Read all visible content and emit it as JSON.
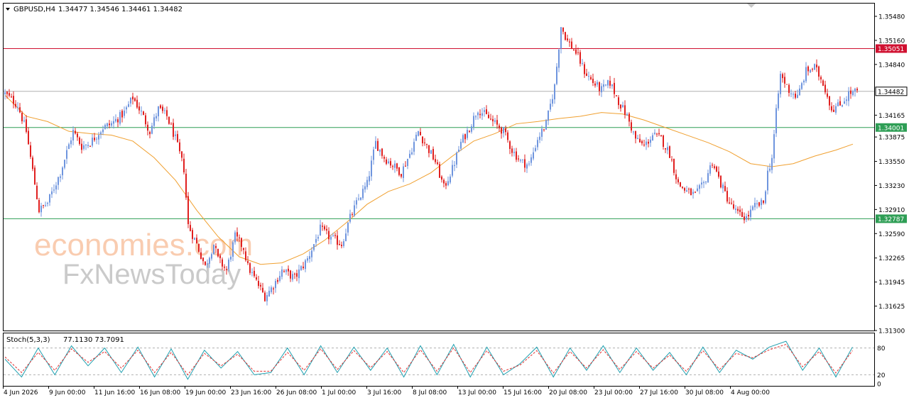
{
  "main_header": {
    "symbol": "GBPUSD,H4",
    "ohlc": "1.34477 1.34546 1.34461 1.34482"
  },
  "stoch_header": {
    "label": "Stoch(5,3,3)",
    "values": "77.1130 73.7091"
  },
  "watermark": {
    "line1": "economies.com",
    "line2": "FxNewsToday"
  },
  "colors": {
    "bull": "#6F95DE",
    "bear": "#E02020",
    "ma": "#F0A030",
    "resistance": "#D01030",
    "support": "#2E9E55",
    "current": "#B0B0B0",
    "stoch_main": "#20A0B0",
    "stoch_signal": "#E03030"
  },
  "chart_data": [
    {
      "type": "candlestick",
      "symbol": "GBPUSD",
      "timeframe": "H4",
      "x_tick_labels": [
        "4 Jun 2026",
        "9 Jun 00:00",
        "11 Jun 16:00",
        "16 Jun 08:00",
        "19 Jun 00:00",
        "23 Jun 16:00",
        "26 Jun 08:00",
        "1 Jul 00:00",
        "3 Jul 16:00",
        "8 Jul 08:00",
        "13 Jul 00:00",
        "15 Jul 16:00",
        "20 Jul 08:00",
        "23 Jul 00:00",
        "27 Jul 16:00",
        "30 Jul 08:00",
        "4 Aug 00:00"
      ],
      "y_tick_labels": [
        "1.35480",
        "1.35160",
        "1.34840",
        "1.34165",
        "1.33875",
        "1.33550",
        "1.33230",
        "1.32910",
        "1.32590",
        "1.32265",
        "1.31945",
        "1.31625",
        "1.31300"
      ],
      "ylim": [
        1.313,
        1.3565
      ],
      "horizontal_levels": [
        {
          "value": 1.35051,
          "label": "1.35051",
          "role": "resistance"
        },
        {
          "value": 1.34482,
          "label": "1.34482",
          "role": "current"
        },
        {
          "value": 1.34001,
          "label": "1.34001",
          "role": "support"
        },
        {
          "value": 1.32787,
          "label": "1.32787",
          "role": "support"
        }
      ],
      "close_path": [
        [
          0,
          1.3445
        ],
        [
          6,
          1.343
        ],
        [
          10,
          1.3395
        ],
        [
          16,
          1.329
        ],
        [
          20,
          1.33
        ],
        [
          26,
          1.334
        ],
        [
          32,
          1.3395
        ],
        [
          36,
          1.3375
        ],
        [
          40,
          1.338
        ],
        [
          46,
          1.34
        ],
        [
          50,
          1.3405
        ],
        [
          56,
          1.342
        ],
        [
          60,
          1.344
        ],
        [
          64,
          1.342
        ],
        [
          68,
          1.3395
        ],
        [
          72,
          1.3425
        ],
        [
          76,
          1.3415
        ],
        [
          80,
          1.3385
        ],
        [
          84,
          1.3345
        ],
        [
          86,
          1.327
        ],
        [
          90,
          1.3245
        ],
        [
          94,
          1.3215
        ],
        [
          98,
          1.3245
        ],
        [
          100,
          1.3225
        ],
        [
          104,
          1.321
        ],
        [
          108,
          1.3255
        ],
        [
          112,
          1.324
        ],
        [
          114,
          1.3215
        ],
        [
          118,
          1.3195
        ],
        [
          122,
          1.3175
        ],
        [
          126,
          1.319
        ],
        [
          130,
          1.321
        ],
        [
          136,
          1.32
        ],
        [
          142,
          1.3225
        ],
        [
          148,
          1.3265
        ],
        [
          152,
          1.3255
        ],
        [
          158,
          1.3245
        ],
        [
          162,
          1.328
        ],
        [
          166,
          1.3305
        ],
        [
          170,
          1.3325
        ],
        [
          174,
          1.338
        ],
        [
          178,
          1.336
        ],
        [
          182,
          1.335
        ],
        [
          186,
          1.334
        ],
        [
          190,
          1.3365
        ],
        [
          194,
          1.3395
        ],
        [
          198,
          1.3375
        ],
        [
          202,
          1.3355
        ],
        [
          206,
          1.332
        ],
        [
          210,
          1.3345
        ],
        [
          214,
          1.338
        ],
        [
          218,
          1.34
        ],
        [
          222,
          1.3425
        ],
        [
          226,
          1.3415
        ],
        [
          230,
          1.3405
        ],
        [
          234,
          1.3395
        ],
        [
          238,
          1.337
        ],
        [
          242,
          1.3355
        ],
        [
          246,
          1.335
        ],
        [
          250,
          1.3385
        ],
        [
          254,
          1.3405
        ],
        [
          258,
          1.3455
        ],
        [
          261,
          1.3535
        ],
        [
          264,
          1.3515
        ],
        [
          268,
          1.35
        ],
        [
          272,
          1.3475
        ],
        [
          276,
          1.346
        ],
        [
          280,
          1.345
        ],
        [
          284,
          1.346
        ],
        [
          288,
          1.3435
        ],
        [
          292,
          1.3415
        ],
        [
          296,
          1.3385
        ],
        [
          300,
          1.3375
        ],
        [
          304,
          1.339
        ],
        [
          308,
          1.3385
        ],
        [
          312,
          1.3365
        ],
        [
          316,
          1.3325
        ],
        [
          320,
          1.3315
        ],
        [
          324,
          1.331
        ],
        [
          328,
          1.3325
        ],
        [
          332,
          1.3355
        ],
        [
          336,
          1.3325
        ],
        [
          340,
          1.33
        ],
        [
          344,
          1.3285
        ],
        [
          348,
          1.328
        ],
        [
          352,
          1.3295
        ],
        [
          356,
          1.33
        ],
        [
          358,
          1.334
        ],
        [
          360,
          1.336
        ],
        [
          362,
          1.342
        ],
        [
          364,
          1.347
        ],
        [
          368,
          1.345
        ],
        [
          372,
          1.344
        ],
        [
          376,
          1.3475
        ],
        [
          380,
          1.348
        ],
        [
          384,
          1.346
        ],
        [
          388,
          1.3425
        ],
        [
          392,
          1.343
        ],
        [
          396,
          1.3445
        ],
        [
          400,
          1.3448
        ]
      ],
      "moving_average": [
        [
          0,
          1.3443
        ],
        [
          10,
          1.3415
        ],
        [
          20,
          1.3408
        ],
        [
          30,
          1.3395
        ],
        [
          40,
          1.3392
        ],
        [
          50,
          1.339
        ],
        [
          60,
          1.3382
        ],
        [
          70,
          1.336
        ],
        [
          80,
          1.333
        ],
        [
          90,
          1.329
        ],
        [
          100,
          1.3255
        ],
        [
          110,
          1.3228
        ],
        [
          120,
          1.3218
        ],
        [
          130,
          1.322
        ],
        [
          140,
          1.3232
        ],
        [
          150,
          1.325
        ],
        [
          160,
          1.3273
        ],
        [
          170,
          1.3298
        ],
        [
          180,
          1.3315
        ],
        [
          190,
          1.3325
        ],
        [
          200,
          1.334
        ],
        [
          210,
          1.3362
        ],
        [
          220,
          1.3382
        ],
        [
          230,
          1.3392
        ],
        [
          240,
          1.3405
        ],
        [
          250,
          1.3408
        ],
        [
          260,
          1.3412
        ],
        [
          270,
          1.3415
        ],
        [
          280,
          1.342
        ],
        [
          290,
          1.3418
        ],
        [
          300,
          1.341
        ],
        [
          310,
          1.34
        ],
        [
          320,
          1.339
        ],
        [
          330,
          1.338
        ],
        [
          340,
          1.3368
        ],
        [
          350,
          1.3352
        ],
        [
          360,
          1.3348
        ],
        [
          370,
          1.3352
        ],
        [
          380,
          1.3362
        ],
        [
          390,
          1.337
        ],
        [
          398,
          1.3378
        ]
      ]
    },
    {
      "type": "line",
      "title": "Stoch(5,3,3)",
      "ylim": [
        0,
        100
      ],
      "y_tick_labels": [
        "80",
        "20",
        "0"
      ],
      "levels": [
        80,
        20
      ],
      "series": [
        {
          "name": "Stoch main",
          "points": [
            [
              0,
              55
            ],
            [
              8,
              15
            ],
            [
              16,
              80
            ],
            [
              24,
              20
            ],
            [
              32,
              85
            ],
            [
              40,
              40
            ],
            [
              48,
              80
            ],
            [
              56,
              25
            ],
            [
              64,
              82
            ],
            [
              72,
              15
            ],
            [
              80,
              78
            ],
            [
              88,
              10
            ],
            [
              96,
              75
            ],
            [
              104,
              35
            ],
            [
              112,
              72
            ],
            [
              120,
              20
            ],
            [
              128,
              25
            ],
            [
              136,
              80
            ],
            [
              144,
              20
            ],
            [
              152,
              85
            ],
            [
              160,
              25
            ],
            [
              168,
              82
            ],
            [
              176,
              30
            ],
            [
              184,
              80
            ],
            [
              192,
              15
            ],
            [
              200,
              85
            ],
            [
              208,
              20
            ],
            [
              216,
              88
            ],
            [
              224,
              15
            ],
            [
              232,
              82
            ],
            [
              240,
              20
            ],
            [
              248,
              45
            ],
            [
              256,
              82
            ],
            [
              264,
              15
            ],
            [
              272,
              80
            ],
            [
              280,
              30
            ],
            [
              288,
              85
            ],
            [
              296,
              25
            ],
            [
              304,
              80
            ],
            [
              312,
              30
            ],
            [
              320,
              70
            ],
            [
              328,
              20
            ],
            [
              336,
              82
            ],
            [
              344,
              25
            ],
            [
              352,
              75
            ],
            [
              360,
              55
            ],
            [
              368,
              82
            ],
            [
              376,
              95
            ],
            [
              384,
              30
            ],
            [
              392,
              80
            ],
            [
              400,
              15
            ],
            [
              408,
              82
            ]
          ]
        },
        {
          "name": "Stoch signal",
          "points": [
            [
              0,
              60
            ],
            [
              8,
              25
            ],
            [
              16,
              70
            ],
            [
              24,
              30
            ],
            [
              32,
              78
            ],
            [
              40,
              48
            ],
            [
              48,
              72
            ],
            [
              56,
              35
            ],
            [
              64,
              75
            ],
            [
              72,
              25
            ],
            [
              80,
              70
            ],
            [
              88,
              20
            ],
            [
              96,
              68
            ],
            [
              104,
              40
            ],
            [
              112,
              66
            ],
            [
              120,
              28
            ],
            [
              128,
              28
            ],
            [
              136,
              70
            ],
            [
              144,
              30
            ],
            [
              152,
              78
            ],
            [
              160,
              32
            ],
            [
              168,
              74
            ],
            [
              176,
              36
            ],
            [
              184,
              72
            ],
            [
              192,
              25
            ],
            [
              200,
              76
            ],
            [
              208,
              28
            ],
            [
              216,
              80
            ],
            [
              224,
              25
            ],
            [
              232,
              74
            ],
            [
              240,
              28
            ],
            [
              248,
              42
            ],
            [
              256,
              74
            ],
            [
              264,
              24
            ],
            [
              272,
              72
            ],
            [
              280,
              35
            ],
            [
              288,
              76
            ],
            [
              296,
              32
            ],
            [
              304,
              72
            ],
            [
              312,
              35
            ],
            [
              320,
              64
            ],
            [
              328,
              28
            ],
            [
              336,
              74
            ],
            [
              344,
              32
            ],
            [
              352,
              68
            ],
            [
              360,
              58
            ],
            [
              368,
              76
            ],
            [
              376,
              88
            ],
            [
              384,
              38
            ],
            [
              392,
              72
            ],
            [
              400,
              24
            ],
            [
              408,
              74
            ]
          ]
        }
      ]
    }
  ]
}
